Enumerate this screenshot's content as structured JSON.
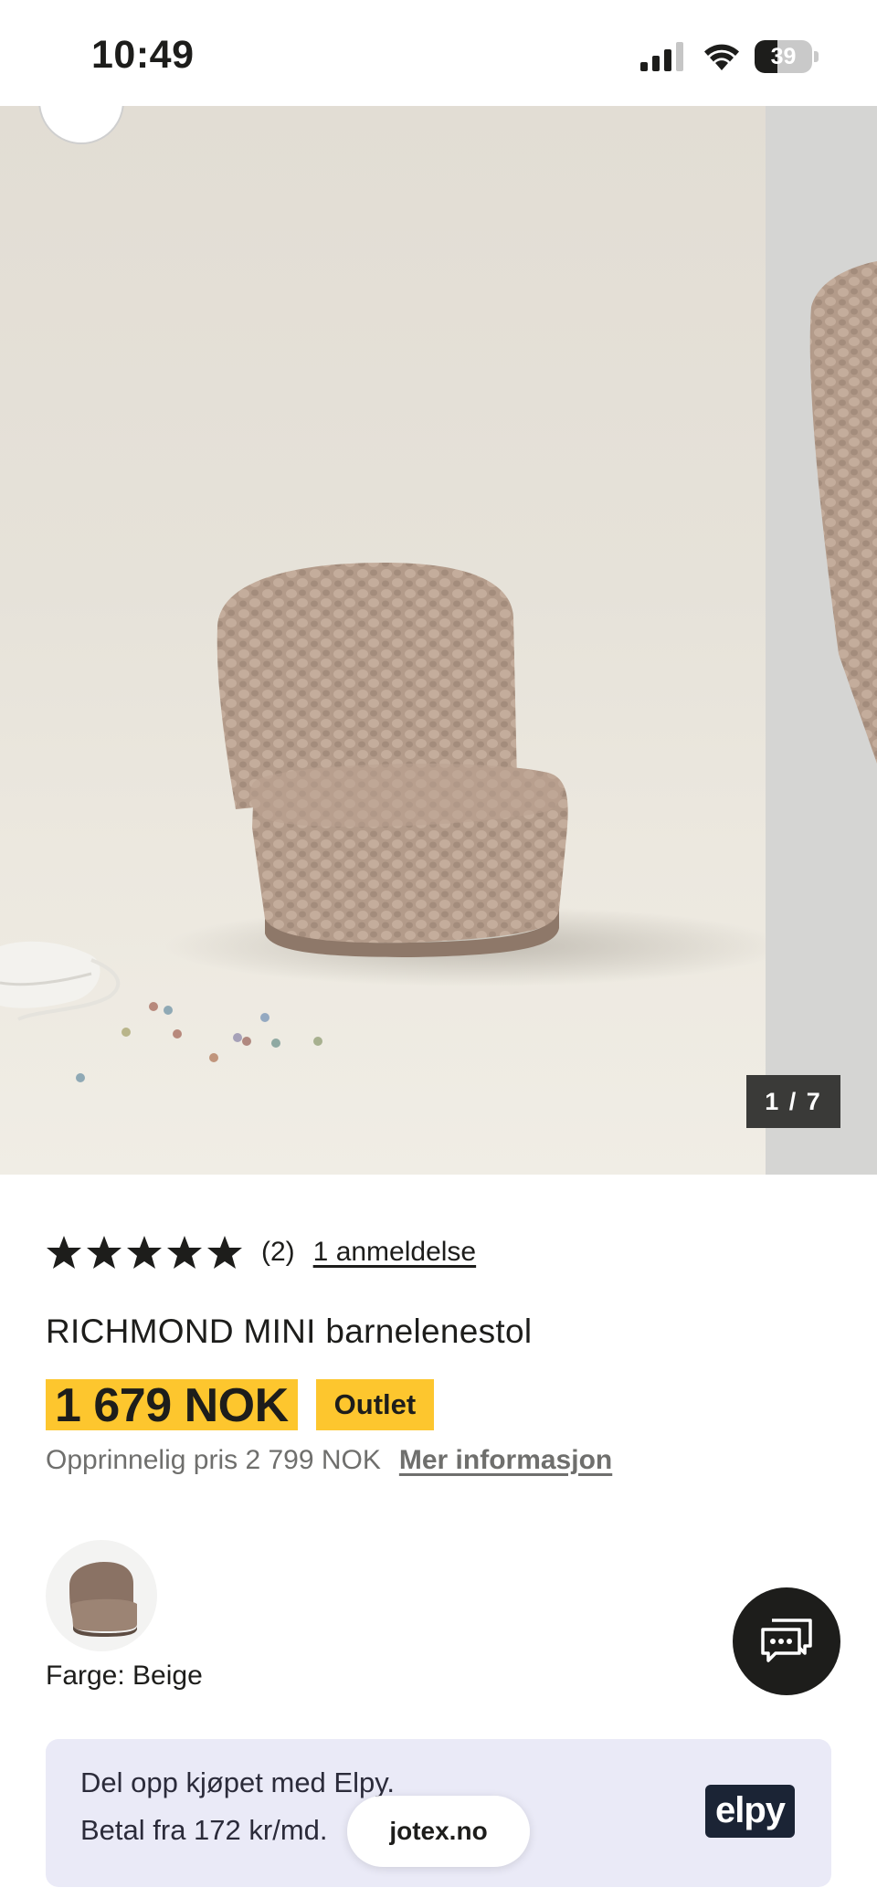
{
  "status_bar": {
    "time": "10:49",
    "battery_level": "39",
    "icons": [
      "signal-icon",
      "wifi-icon",
      "battery-icon"
    ]
  },
  "gallery": {
    "counter": "1 / 7",
    "current": 1,
    "total": 7
  },
  "product": {
    "rating": 5,
    "rating_count": "(2)",
    "reviews_link": "1 anmeldelse",
    "title": "RICHMOND MINI barnelenestol",
    "price": "1 679 NOK",
    "badge": "Outlet",
    "original_price": "Opprinnelig pris 2 799 NOK",
    "more_info_link": "Mer informasjon",
    "color_label": "Farge: Beige"
  },
  "payment_banner": {
    "line1": "Del opp kjøpet med Elpy.",
    "line2": "Betal fra 172 kr/md.",
    "logo_text": "elpy"
  },
  "browser": {
    "url": "jotex.no"
  },
  "colors": {
    "accent_yellow": "#fdc62e",
    "text_dark": "#1d1d1b",
    "banner_bg": "#eaeaf7",
    "elpy_brand": "#1b2435"
  }
}
